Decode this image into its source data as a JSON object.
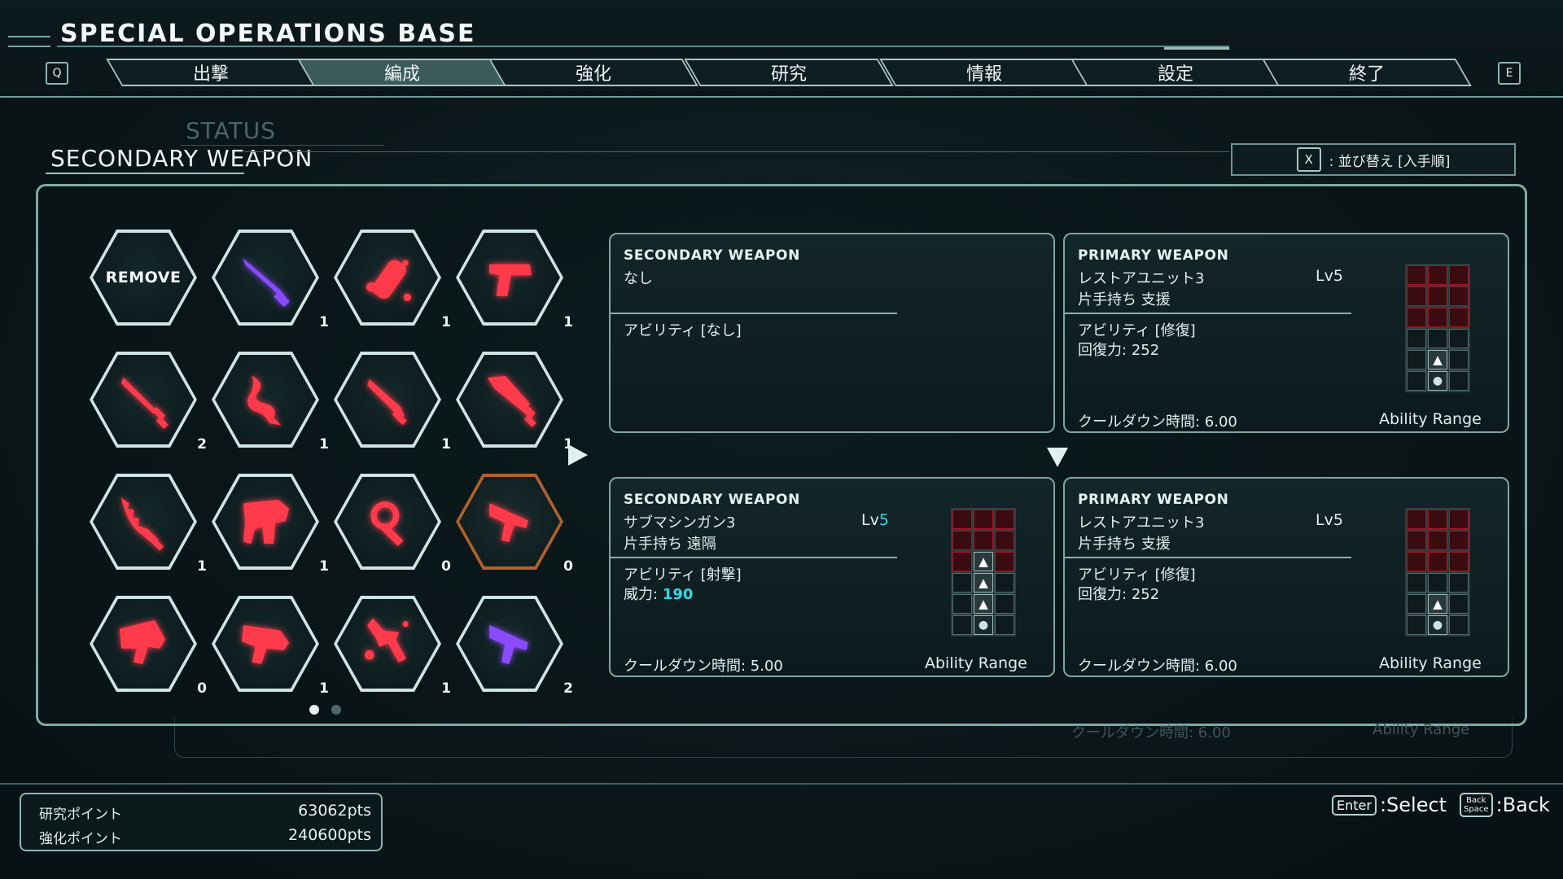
{
  "header": {
    "title": "SPECIAL OPERATIONS BASE",
    "left_key": "Q",
    "right_key": "E",
    "tabs": [
      "出撃",
      "編成",
      "強化",
      "研究",
      "情報",
      "設定",
      "終了"
    ],
    "active_tab": "編成"
  },
  "section": {
    "ghost_label": "STATUS",
    "title": "SECONDARY WEAPON"
  },
  "sort": {
    "key": "X",
    "label": ": 並び替え [入手順]"
  },
  "inventory": {
    "remove_label": "REMOVE",
    "items": [
      {
        "icon": "purple-combat-knife-icon",
        "count": "1",
        "color": "#8a4bff"
      },
      {
        "icon": "red-grenade-icon",
        "count": "1",
        "color": "#ff3a4a"
      },
      {
        "icon": "red-pistol-icon",
        "count": "1",
        "color": "#ff3a4a"
      },
      {
        "icon": "red-dagger-icon",
        "count": "2",
        "color": "#ff3a4a"
      },
      {
        "icon": "red-wavy-blade-icon",
        "count": "1",
        "color": "#ff3a4a"
      },
      {
        "icon": "red-short-knife-icon",
        "count": "1",
        "color": "#ff3a4a"
      },
      {
        "icon": "red-heavy-blade-icon",
        "count": "1",
        "color": "#ff3a4a"
      },
      {
        "icon": "red-serrated-blade-icon",
        "count": "1",
        "color": "#ff3a4a"
      },
      {
        "icon": "red-heavy-gun-icon",
        "count": "1",
        "color": "#ff3a4a"
      },
      {
        "icon": "red-gear-wrench-icon",
        "count": "0",
        "color": "#ff3a4a"
      },
      {
        "icon": "red-submachine-gun-icon",
        "count": "0",
        "color": "#ff3a4a"
      },
      {
        "icon": "red-launcher-icon",
        "count": "0",
        "color": "#ff3a4a"
      },
      {
        "icon": "red-blaster-icon",
        "count": "1",
        "color": "#ff3a4a"
      },
      {
        "icon": "red-spray-gun-icon",
        "count": "1",
        "color": "#ff3a4a"
      },
      {
        "icon": "purple-submachine-gun-icon",
        "count": "2",
        "color": "#8a4bff"
      }
    ],
    "page_dots": 2,
    "active_page": 1
  },
  "cards": {
    "current_secondary": {
      "type": "SECONDARY WEAPON",
      "name": "なし",
      "ability": "アビリティ [なし]"
    },
    "current_primary": {
      "type": "PRIMARY WEAPON",
      "name": "レストアユニット3",
      "level": "Lv5",
      "desc": "片手持ち 支援",
      "ability": "アビリティ [修復]",
      "stat_label": "回復力:",
      "stat_value": "252",
      "cooldown": "クールダウン時間: 6.00",
      "range_label": "Ability Range"
    },
    "new_secondary": {
      "type": "SECONDARY WEAPON",
      "name": "サブマシンガン3",
      "level_prefix": "Lv",
      "level_value": "5",
      "desc": "片手持ち 遠隔",
      "ability": "アビリティ [射撃]",
      "stat_label": "威力:",
      "stat_value": "190",
      "cooldown": "クールダウン時間: 5.00",
      "range_label": "Ability Range"
    },
    "new_primary": {
      "type": "PRIMARY WEAPON",
      "name": "レストアユニット3",
      "level": "Lv5",
      "desc": "片手持ち 支援",
      "ability": "アビリティ [修復]",
      "stat_label": "回復力:",
      "stat_value": "252",
      "cooldown": "クールダウン時間: 6.00",
      "range_label": "Ability Range"
    },
    "ghost_cooldown": "クールダウン時間: 6.00",
    "ghost_range": "Ability Range"
  },
  "points": {
    "research_label": "研究ポイント",
    "research_value": "63062pts",
    "upgrade_label": "強化ポイント",
    "upgrade_value": "240600pts"
  },
  "controls": {
    "select_key": "Enter",
    "select_label": ":Select",
    "back_key_line1": "Back",
    "back_key_line2": "Space",
    "back_label": ":Back"
  },
  "colors": {
    "accent_cyan": "#33d9e6",
    "frame": "#7faaa9",
    "weapon_red": "#ff3a4a",
    "weapon_purple": "#8a4bff",
    "selected_frame": "#b0622e"
  }
}
